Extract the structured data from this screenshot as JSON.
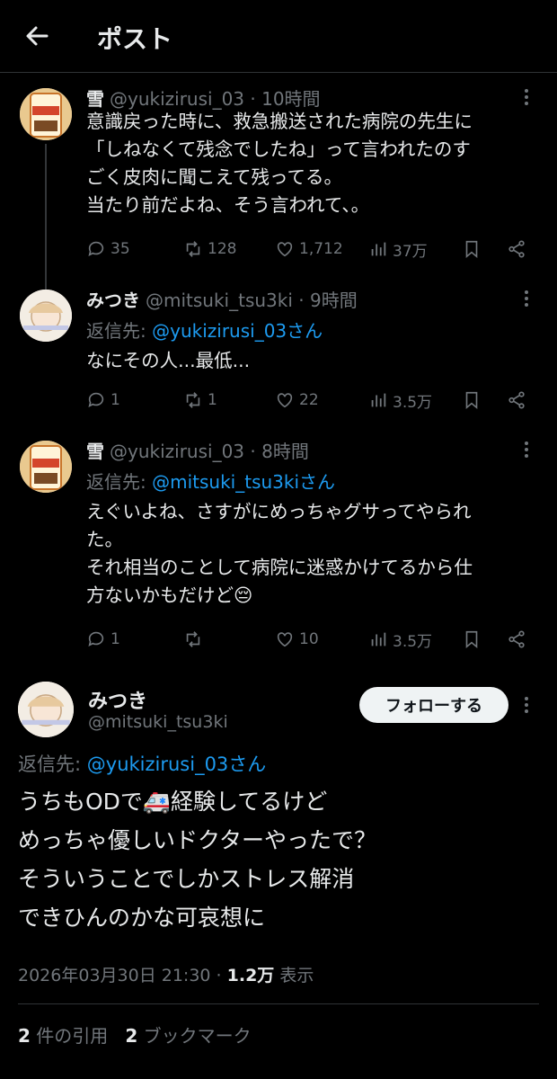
{
  "header": {
    "title": "ポスト"
  },
  "tweets": [
    {
      "name": "雪",
      "handle": "@yukizirusi_03",
      "time": "· 10時間",
      "lines": [
        "意識戻った時に、救急搬送された病院の先生に",
        "「しねなくて残念でしたね」って言われたのす",
        "ごく皮肉に聞こえて残ってる。",
        "当たり前だよね、そう言われて、。"
      ],
      "replies": "35",
      "reposts": "128",
      "likes": "1,712",
      "views": "37万"
    },
    {
      "name": "みつき",
      "handle": "@mitsuki_tsu3ki",
      "time": "· 9時間",
      "reply_prefix": "返信先: ",
      "reply_handle": "@yukizirusi_03さん",
      "lines": [
        "なにその人...最低..."
      ],
      "replies": "1",
      "reposts": "1",
      "likes": "22",
      "views": "3.5万"
    },
    {
      "name": "雪",
      "handle": "@yukizirusi_03",
      "time": "· 8時間",
      "reply_prefix": "返信先: ",
      "reply_handle": "@mitsuki_tsu3kiさん",
      "lines": [
        "えぐいよね、さすがにめっちゃグサってやられ",
        "た。",
        "それ相当のことして病院に迷惑かけてるから仕",
        "方ないかもだけど😔"
      ],
      "replies": "1",
      "reposts": "",
      "likes": "10",
      "views": "3.5万"
    }
  ],
  "main_post": {
    "name": "みつき",
    "handle": "@mitsuki_tsu3ki",
    "follow_label": "フォローする",
    "reply_prefix": "返信先: ",
    "reply_handle": "@yukizirusi_03さん",
    "lines": [
      "うちもODで🚑経験してるけど",
      "めっちゃ優しいドクターやったで？",
      "そういうことでしかストレス解消",
      "できひんのかな可哀想に"
    ],
    "datetime": "2026年03月30日 21:30",
    "dot": " · ",
    "views_count": "1.2万",
    "views_label": " 表示",
    "quotes_count": "2",
    "quotes_label": " 件の引用",
    "bookmarks_count": "2",
    "bookmarks_label": " ブックマーク"
  },
  "icons": {
    "back": "back-arrow-icon",
    "more": "more-horizontal-icon",
    "reply": "reply-icon",
    "repost": "repost-icon",
    "like": "heart-icon",
    "views": "bar-chart-icon",
    "bookmark": "bookmark-icon",
    "share": "share-icon"
  },
  "colors": {
    "background": "#000000",
    "text": "#e7e9ea",
    "muted": "#71767b",
    "link": "#1d9bf0"
  }
}
